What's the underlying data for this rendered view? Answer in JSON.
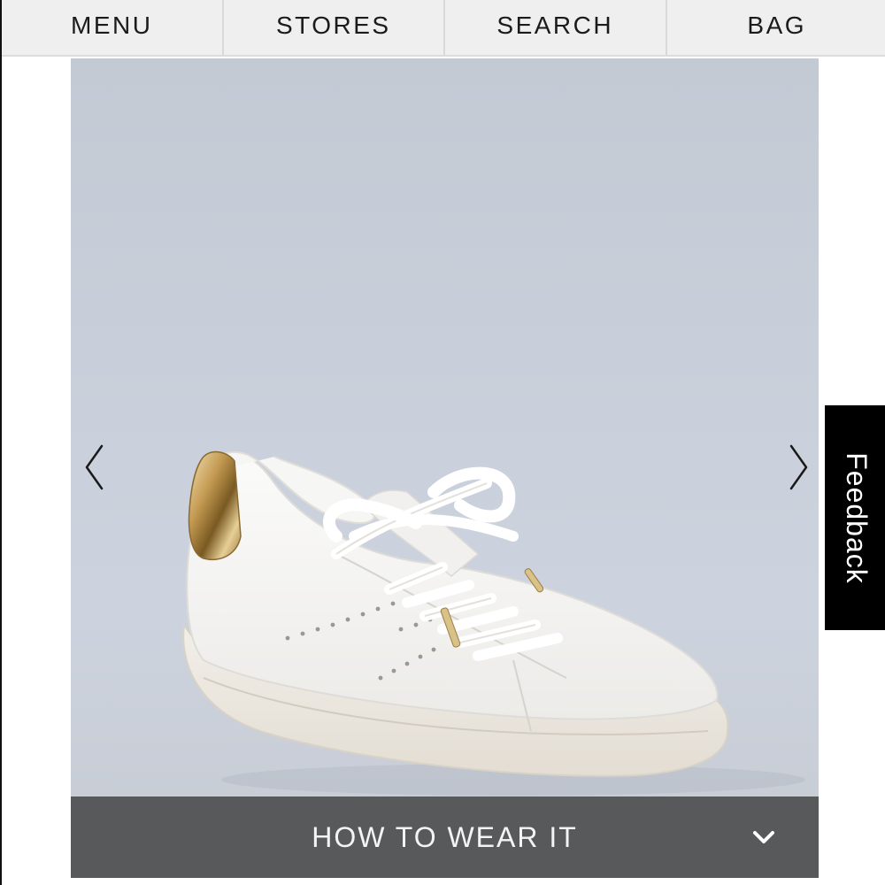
{
  "nav": {
    "menu": "MENU",
    "stores": "STORES",
    "search": "SEARCH",
    "bag": "BAG"
  },
  "carousel": {
    "prev_icon": "chevron-left-icon",
    "next_icon": "chevron-right-icon"
  },
  "accordion": {
    "label": "HOW TO WEAR IT",
    "icon": "chevron-down-icon"
  },
  "feedback": {
    "label": "Feedback"
  },
  "colors": {
    "nav_bg": "#efefef",
    "image_bg": "#c9cfda",
    "accordion_bg": "#58595b",
    "feedback_bg": "#000000"
  }
}
